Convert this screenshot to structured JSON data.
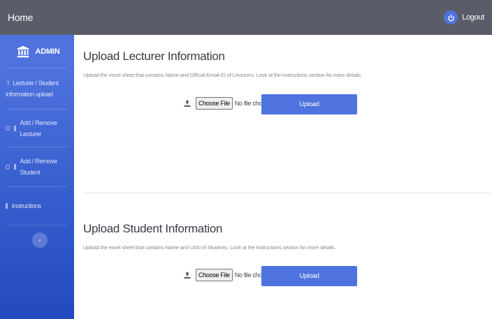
{
  "topbar": {
    "title": "Home",
    "logout_label": "Logout"
  },
  "sidebar": {
    "brand": "ADMIN",
    "items": [
      {
        "line1": "Lecturer / Student",
        "line2": "information upload"
      },
      {
        "label": "Add / Remove Lecturer"
      },
      {
        "label": "Add / Remove Student"
      },
      {
        "label": "Instructions"
      }
    ],
    "toggle_glyph": "‹"
  },
  "lecturer_section": {
    "title": "Upload Lecturer Information",
    "description": "Upload the excel sheet that contains Name and Official Email-ID of Lecturers. Look at the instructions section for more details.",
    "choose_file_label": "Choose File",
    "no_file_text": "No file chosen",
    "upload_label": "Upload"
  },
  "student_section": {
    "title": "Upload Student Information",
    "description": "Upload the excel sheet that contains Name and USN of Students. Look at the instructions section for more details.",
    "choose_file_label": "Choose File",
    "no_file_text": "No file chosen",
    "upload_label": "Upload"
  },
  "colors": {
    "primary": "#4e73df",
    "topbar": "#5a5c69",
    "sidebar_dark": "#224abe"
  }
}
